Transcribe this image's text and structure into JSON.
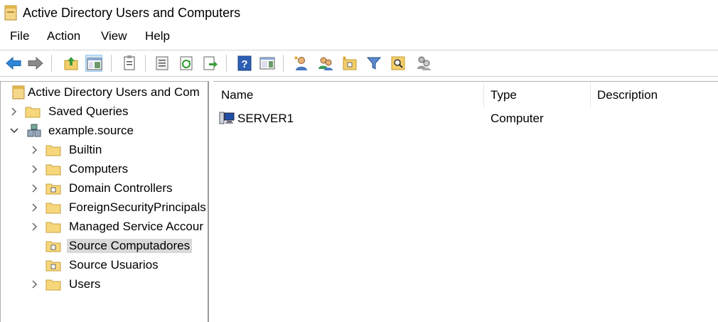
{
  "window": {
    "title": "Active Directory Users and Computers"
  },
  "menu": {
    "file": "File",
    "action": "Action",
    "view": "View",
    "help": "Help"
  },
  "toolbar": {
    "icons": [
      "back-arrow-icon",
      "forward-arrow-icon",
      "up-folder-icon",
      "show-hide-console-tree-icon",
      "properties-icon",
      "export-list-icon",
      "refresh-icon",
      "help-icon",
      "show-action-pane-icon",
      "new-user-icon",
      "new-group-icon",
      "new-ou-icon",
      "filter-icon",
      "find-icon",
      "delegate-control-icon"
    ]
  },
  "tree": {
    "root": "Active Directory Users and Com",
    "saved_queries": "Saved Queries",
    "domain": "example.source",
    "builtin": "Builtin",
    "computers": "Computers",
    "domain_controllers": "Domain Controllers",
    "foreign_security_principals": "ForeignSecurityPrincipals",
    "managed_service_accounts": "Managed Service Accour",
    "source_computadores": "Source Computadores",
    "source_usuarios": "Source Usuarios",
    "users": "Users"
  },
  "list": {
    "columns": {
      "name": "Name",
      "type": "Type",
      "description": "Description"
    },
    "rows": [
      {
        "name": "SERVER1",
        "type": "Computer",
        "description": ""
      }
    ]
  }
}
